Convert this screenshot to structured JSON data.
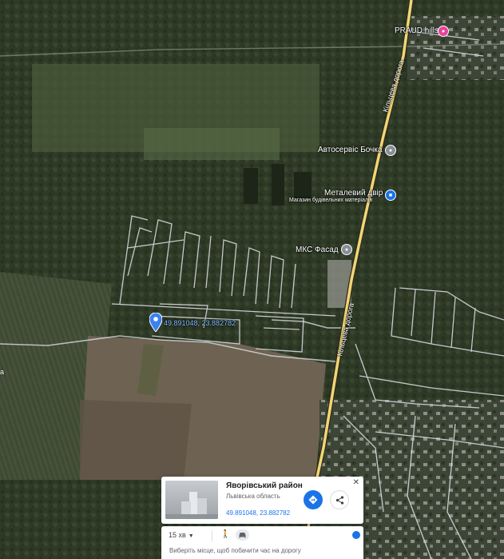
{
  "map": {
    "pois": [
      {
        "name": "PRAUD hills",
        "icon": "hotel-icon",
        "color": "#e6459b"
      },
      {
        "name": "Автосервіс Бочка",
        "icon": "place-icon",
        "color": "#8a8f95"
      },
      {
        "name": "Металевий двір",
        "subtitle": "Магазин будівельних матеріалів",
        "icon": "shopping-icon",
        "color": "#1a73e8"
      },
      {
        "name": "МКС Фасад",
        "icon": "place-icon",
        "color": "#8a8f95"
      }
    ],
    "roads": [
      {
        "name": "Кільцева дорога"
      },
      {
        "name": "Кільцева дорога"
      }
    ],
    "pin_coords": "49.891048, 23.882782",
    "edge_label": "а",
    "road_color": "#f2d675"
  },
  "place_card": {
    "title": "Яворівський район",
    "subtitle": "Львівська область",
    "coords": "49.891048, 23.882782",
    "close_icon": "close-icon",
    "directions_icon": "directions-icon",
    "share_icon": "share-icon"
  },
  "travel": {
    "time_label": "15 хв",
    "hint": "Виберіть місце, щоб побачити час на дорогу",
    "modes": [
      "walk-icon",
      "car-icon"
    ],
    "accent_color": "#1a73e8"
  }
}
